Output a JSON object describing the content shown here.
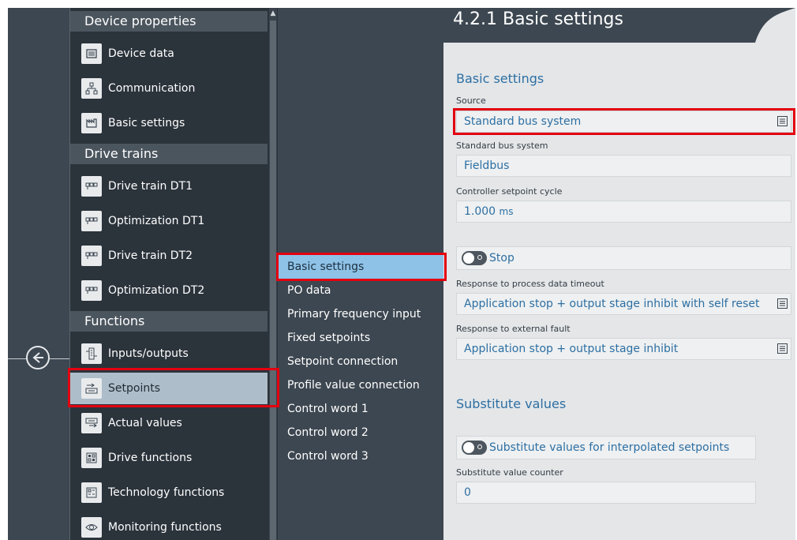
{
  "nav": {
    "groups": [
      "Device properties",
      "Drive trains",
      "Functions"
    ],
    "items": [
      {
        "label": "Device data",
        "icon": "device-data-icon"
      },
      {
        "label": "Communication",
        "icon": "network-icon"
      },
      {
        "label": "Basic settings",
        "icon": "basic-settings-icon"
      },
      {
        "label": "Drive train DT1",
        "icon": "drive-train-icon"
      },
      {
        "label": "Optimization DT1",
        "icon": "drive-train-icon"
      },
      {
        "label": "Drive train DT2",
        "icon": "drive-train-icon"
      },
      {
        "label": "Optimization DT2",
        "icon": "drive-train-icon"
      },
      {
        "label": "Inputs/outputs",
        "icon": "inputs-outputs-icon"
      },
      {
        "label": "Setpoints",
        "icon": "setpoints-icon"
      },
      {
        "label": "Actual values",
        "icon": "actual-values-icon"
      },
      {
        "label": "Drive functions",
        "icon": "drive-functions-icon"
      },
      {
        "label": "Technology functions",
        "icon": "technology-functions-icon"
      },
      {
        "label": "Monitoring functions",
        "icon": "monitoring-icon"
      }
    ],
    "selected": "Setpoints"
  },
  "subnav": {
    "items": [
      "Basic settings",
      "PO data",
      "Primary frequency input",
      "Fixed setpoints",
      "Setpoint connection",
      "Profile value connection",
      "Control word 1",
      "Control word 2",
      "Control word 3"
    ],
    "selected": "Basic settings"
  },
  "panel": {
    "title": "4.2.1 Basic settings",
    "basic_section": "Basic settings",
    "source_label": "Source",
    "source_value": "Standard bus system",
    "std_bus_label": "Standard bus system",
    "std_bus_value": "Fieldbus",
    "cycle_label": "Controller setpoint cycle",
    "cycle_value": "1.000",
    "cycle_unit": "ms",
    "stop_toggle_label": "Stop",
    "pd_timeout_label": "Response to process data timeout",
    "pd_timeout_value": "Application stop + output stage inhibit with self reset",
    "ext_fault_label": "Response to external fault",
    "ext_fault_value": "Application stop + output stage inhibit",
    "substitute_section": "Substitute values",
    "substitute_toggle_label": "Substitute values for interpolated setpoints",
    "counter_label": "Substitute value counter",
    "counter_value": "0"
  },
  "colors": {
    "accent_text": "#2d6fa3",
    "selected_subnav": "#8ec2e7",
    "selected_nav": "#aebdca",
    "highlight": "#e3000f"
  }
}
